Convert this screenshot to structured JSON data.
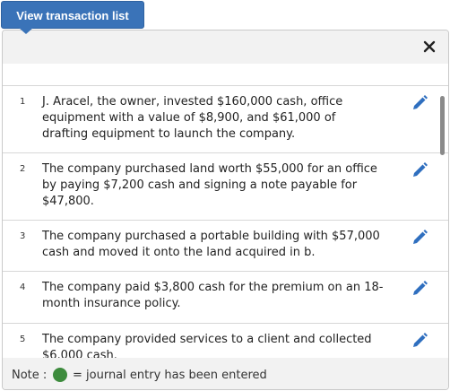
{
  "toolbar": {
    "view_button_label": "View transaction list"
  },
  "dialog": {
    "close_icon": "close-icon",
    "edit_icon": "pencil-icon",
    "items": [
      {
        "num": "1",
        "text": "J. Aracel, the owner, invested $160,000 cash, office equipment with a value of $8,900, and $61,000 of drafting equipment to launch the company."
      },
      {
        "num": "2",
        "text": "The company purchased land worth $55,000 for an office by paying $7,200 cash and signing a note payable for $47,800."
      },
      {
        "num": "3",
        "text": "The company purchased a portable building with $57,000 cash and moved it onto the land acquired in b."
      },
      {
        "num": "4",
        "text": "The company paid $3,800 cash for the premium on an 18-month insurance policy."
      },
      {
        "num": "5",
        "text": "The company provided services to a client and collected $6,000 cash."
      }
    ]
  },
  "note": {
    "label": "Note :",
    "text": "= journal entry has been entered",
    "dot_color": "#3d8b3d"
  },
  "colors": {
    "accent": "#3a73b8",
    "edit_icon": "#2f6fbf"
  }
}
